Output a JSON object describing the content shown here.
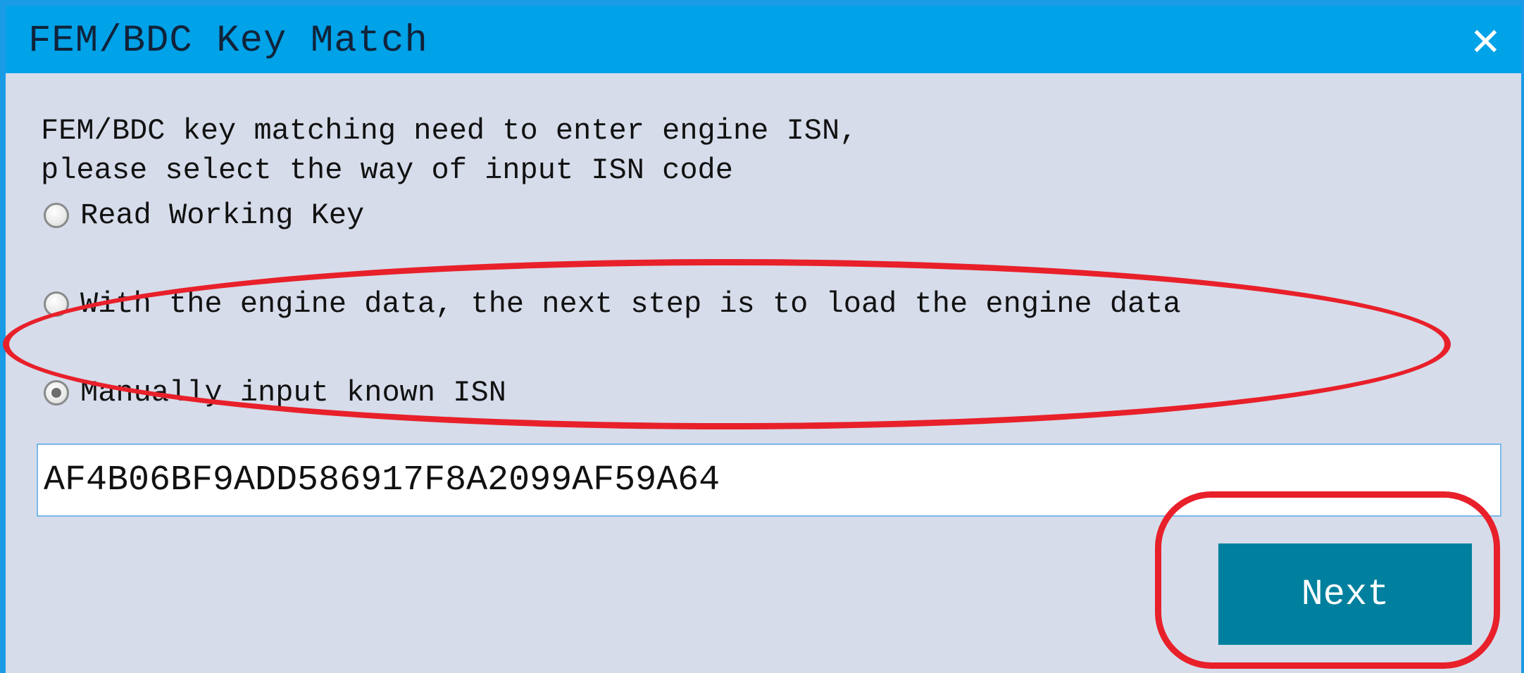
{
  "window": {
    "title": "FEM/BDC Key Match",
    "close_glyph": "✕",
    "colors": {
      "titlebar": "#00a2e8",
      "body": "#d6dcea",
      "button": "#00809e",
      "annotation": "#e8202a"
    }
  },
  "content": {
    "description_line1": "FEM/BDC key matching need to enter engine ISN,",
    "description_line2": "please select the way of input ISN code",
    "options": [
      {
        "label": "Read Working Key",
        "selected": false
      },
      {
        "label": "With the engine data, the next step is to load the engine data",
        "selected": false
      },
      {
        "label": "Manually input known ISN",
        "selected": true
      }
    ],
    "isn_value": "AF4B06BF9ADD586917F8A2099AF59A64"
  },
  "actions": {
    "next_label": "Next"
  }
}
